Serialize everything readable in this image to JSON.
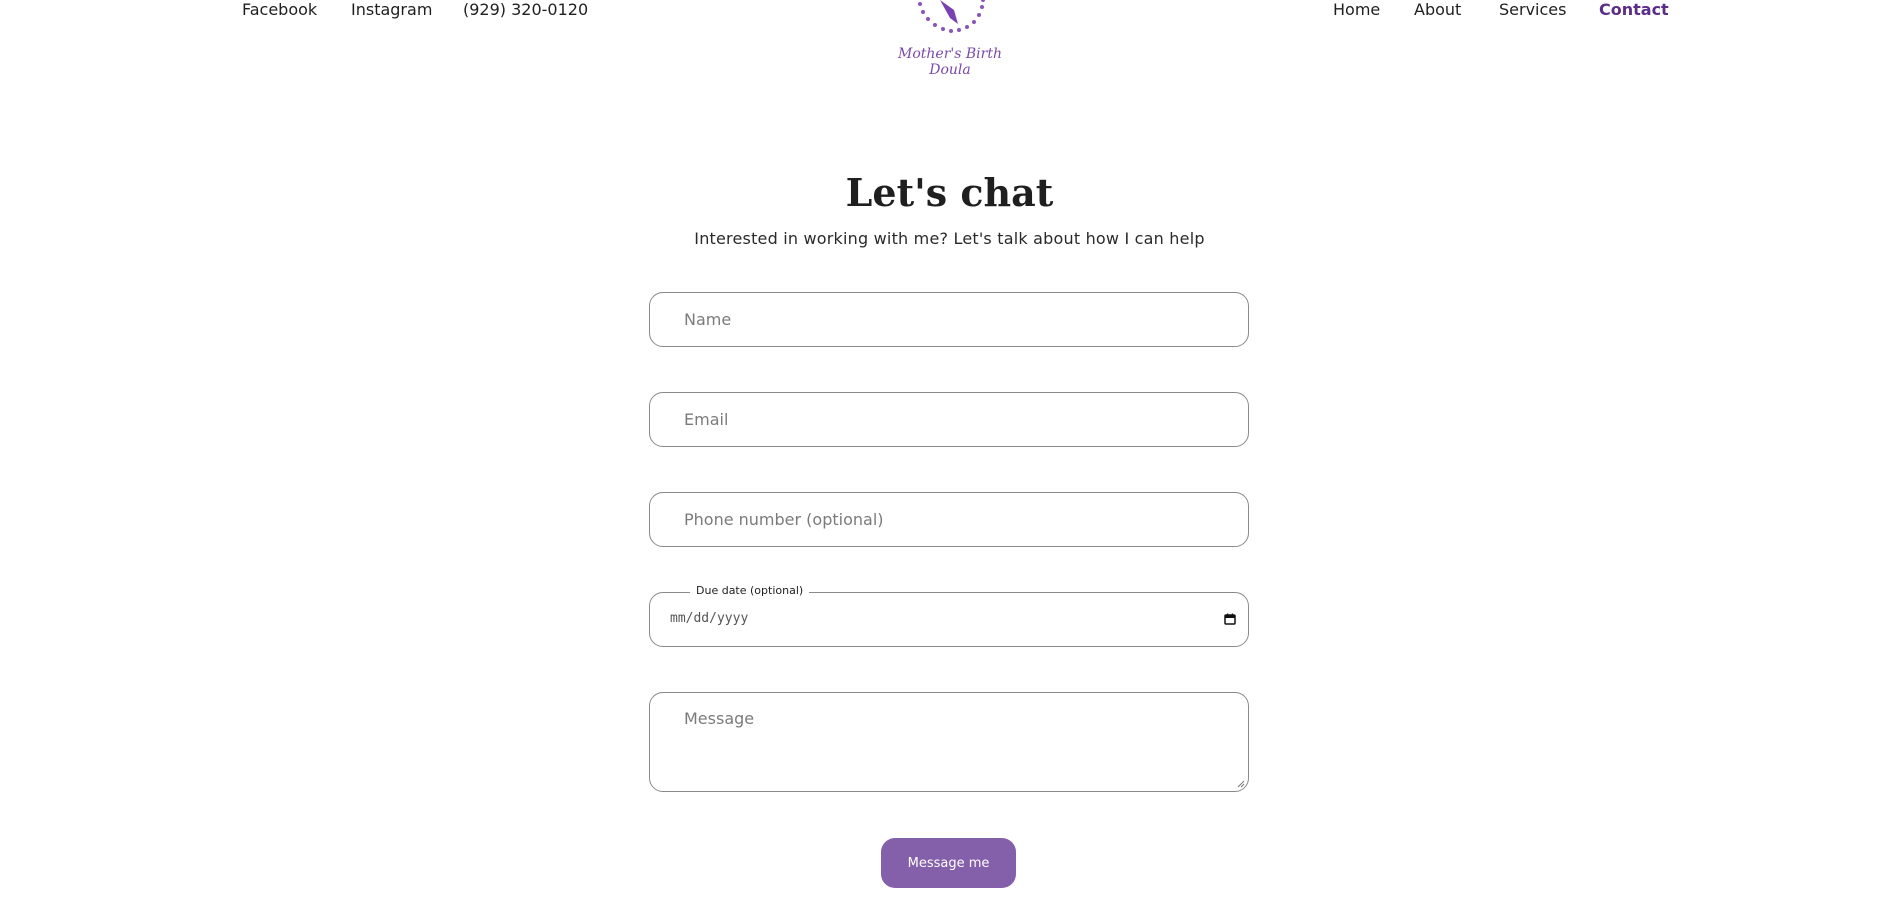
{
  "header": {
    "social": {
      "facebook": "Facebook",
      "instagram": "Instagram",
      "phone": "(929) 320-0120"
    },
    "logo": {
      "text": "Mother's Birth Doula",
      "icon": "doula-logo-icon"
    },
    "nav": {
      "home": "Home",
      "about": "About",
      "services": "Services",
      "contact": "Contact"
    }
  },
  "main": {
    "title": "Let's chat",
    "subtitle": "Interested in working with me? Let's talk about how I can help",
    "form": {
      "name_placeholder": "Name",
      "email_placeholder": "Email",
      "phone_placeholder": "Phone number (optional)",
      "due_date_label": "Due date (optional)",
      "due_date_value": "mm/dd/yyyy",
      "message_placeholder": "Message",
      "submit_label": "Message me"
    }
  },
  "colors": {
    "accent": "#8560aa",
    "active_nav": "#5b2d8a",
    "logo": "#7a4aa8"
  }
}
